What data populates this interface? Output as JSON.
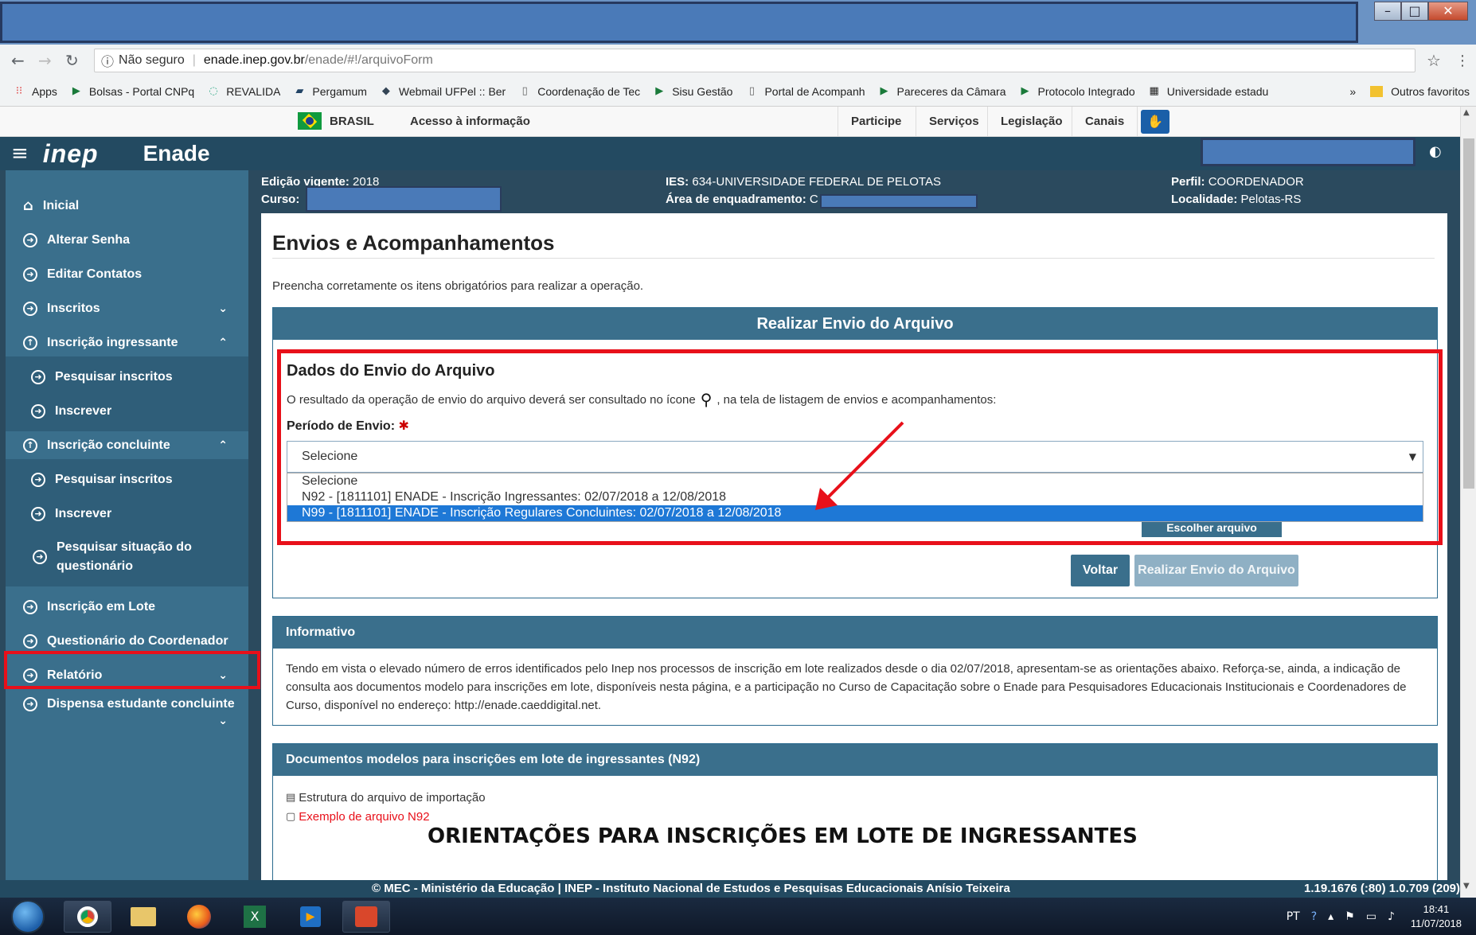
{
  "browser": {
    "url_security": "Não seguro",
    "url_host": "enade.inep.gov.br",
    "url_path": "/enade/#!/arquivoForm",
    "bookmarks": [
      {
        "label": "Apps",
        "icon": "apps-grid-icon"
      },
      {
        "label": "Bolsas - Portal CNPq",
        "icon": "bookmark-icon"
      },
      {
        "label": "REVALIDA",
        "icon": "loading-icon"
      },
      {
        "label": "Pergamum",
        "icon": "book-icon"
      },
      {
        "label": "Webmail UFPel :: Ber",
        "icon": "mail-icon"
      },
      {
        "label": "Coordenação de Tec",
        "icon": "page-icon"
      },
      {
        "label": "Sisu Gestão",
        "icon": "bookmark-icon"
      },
      {
        "label": "Portal de Acompanh",
        "icon": "page-icon"
      },
      {
        "label": "Pareceres da Câmara",
        "icon": "bookmark-icon"
      },
      {
        "label": "Protocolo Integrado",
        "icon": "bookmark-icon"
      },
      {
        "label": "Universidade estadu",
        "icon": "grid-icon"
      }
    ],
    "bookmarks_more": "»",
    "other_bookmarks": "Outros favoritos"
  },
  "govbar": {
    "brasil": "BRASIL",
    "acesso": "Acesso à informação",
    "links": [
      "Participe",
      "Serviços",
      "Legislação",
      "Canais"
    ]
  },
  "header": {
    "logo": "inep",
    "app_title": "Enade"
  },
  "info": {
    "edicao_label": "Edição vigente:",
    "edicao_value": "2018",
    "curso_label": "Curso:",
    "ies_label": "IES:",
    "ies_value": "634-UNIVERSIDADE FEDERAL DE PELOTAS",
    "area_label": "Área de enquadramento:",
    "area_value": "C",
    "perfil_label": "Perfil:",
    "perfil_value": "COORDENADOR",
    "localidade_label": "Localidade:",
    "localidade_value": "Pelotas-RS"
  },
  "sidebar": {
    "items": [
      {
        "label": "Inicial"
      },
      {
        "label": "Alterar Senha"
      },
      {
        "label": "Editar Contatos"
      },
      {
        "label": "Inscritos"
      },
      {
        "label": "Inscrição ingressante"
      },
      {
        "label": "Pesquisar inscritos"
      },
      {
        "label": "Inscrever"
      },
      {
        "label": "Inscrição concluinte"
      },
      {
        "label": "Pesquisar inscritos"
      },
      {
        "label": "Inscrever"
      },
      {
        "label": "Pesquisar situação do questionário"
      },
      {
        "label": "Inscrição em Lote"
      },
      {
        "label": "Questionário do Coordenador"
      },
      {
        "label": "Relatório"
      },
      {
        "label": "Dispensa estudante concluinte"
      }
    ]
  },
  "main": {
    "title": "Envios e Acompanhamentos",
    "instructions": "Preencha corretamente os itens obrigatórios para realizar a operação.",
    "envio_header": "Realizar Envio do Arquivo",
    "dados_title": "Dados do Envio do Arquivo",
    "dados_desc_before": "O resultado da operação de envio do arquivo deverá ser consultado no ícone",
    "dados_desc_after": ", na tela de listagem de envios e acompanhamentos:",
    "periodo_label": "Período de Envio:",
    "required_mark": "✱",
    "select_value": "Selecione",
    "options": [
      "Selecione",
      "N92 - [1811101] ENADE - Inscrição Ingressantes: 02/07/2018 a 12/08/2018",
      "N99 - [1811101] ENADE - Inscrição Regulares Concluintes: 02/07/2018 a 12/08/2018"
    ],
    "escolher_label": "Escolher arquivo",
    "voltar_label": "Voltar",
    "realizar_label": "Realizar Envio do Arquivo",
    "informativo_header": "Informativo",
    "informativo_text": "Tendo em vista o elevado número de erros identificados pelo Inep nos processos de inscrição em lote realizados desde o dia 02/07/2018, apresentam-se as orientações abaixo. Reforça-se, ainda, a indicação de consulta aos documentos modelo para inscrições em lote, disponíveis nesta página, e a participação no Curso de Capacitação sobre o Enade para Pesquisadores Educacionais Institucionais e Coordenadores de Curso, disponível no endereço: http://enade.caeddigital.net.",
    "docs_header": "Documentos modelos para inscrições em lote de ingressantes (N92)",
    "doc_estrutura": "Estrutura do arquivo de importação",
    "doc_exemplo": "Exemplo de arquivo N92",
    "orient_title": "ORIENTAÇÕES PARA INSCRIÇÕES EM LOTE DE INGRESSANTES"
  },
  "footer": {
    "text": "© MEC - Ministério da Educação | INEP - Instituto Nacional de Estudos e Pesquisas Educacionais Anísio Teixeira",
    "version": "1.19.1676 (:80)  1.0.709 (209)"
  },
  "taskbar": {
    "lang": "PT",
    "time": "18:41",
    "date": "11/07/2018"
  }
}
